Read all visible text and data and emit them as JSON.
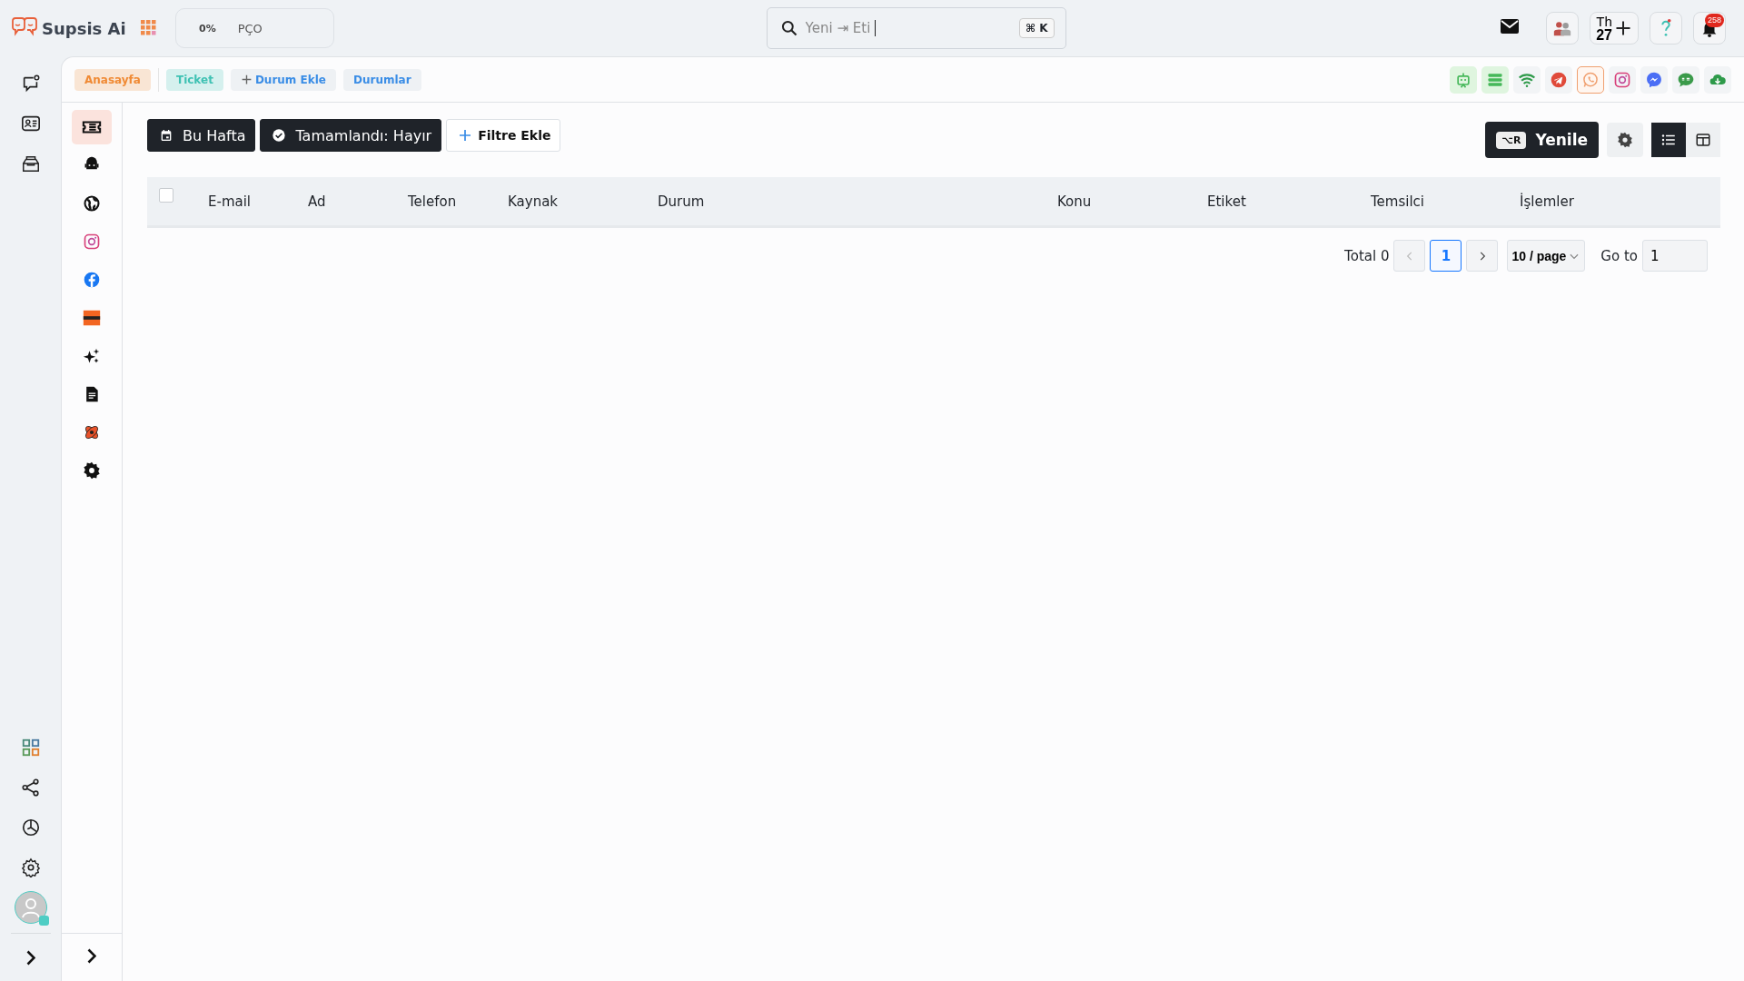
{
  "brand": {
    "name": "Supsis Ai"
  },
  "progress": {
    "percent": "0%",
    "label": "PÇO"
  },
  "search": {
    "value": "Yeni ⇥ Eti",
    "shortcut": "⌘ K"
  },
  "header_actions": {
    "calendar_day": "Th",
    "calendar_date": "27",
    "notification_count": "258"
  },
  "rail": {
    "items": [
      {
        "kind": "chat"
      },
      {
        "kind": "contact"
      },
      {
        "kind": "inbox"
      }
    ],
    "bottom_items": [
      {
        "kind": "apps"
      },
      {
        "kind": "share"
      },
      {
        "kind": "chart"
      },
      {
        "kind": "settings"
      }
    ],
    "user_online": true
  },
  "nav_tabs": [
    {
      "label": "Anasayfa",
      "color": "#f08a34",
      "kind": "tab"
    },
    {
      "label": "Ticket",
      "color": "#3ec1b3",
      "kind": "tab"
    },
    {
      "label": "Durum Ekle",
      "color": "#3a8de6",
      "kind": "add"
    },
    {
      "label": "Durumlar",
      "color": "#3a8de6",
      "kind": "tab"
    }
  ],
  "channels": [
    {
      "kind": "bot",
      "active": true,
      "selected": false
    },
    {
      "kind": "list",
      "active": true,
      "selected": false
    },
    {
      "kind": "wifi",
      "active": false,
      "selected": false
    },
    {
      "kind": "telegram",
      "active": false,
      "selected": false
    },
    {
      "kind": "whatsapp",
      "active": false,
      "selected": true
    },
    {
      "kind": "instagram",
      "active": false,
      "selected": false
    },
    {
      "kind": "messenger",
      "active": false,
      "selected": false
    },
    {
      "kind": "sms",
      "active": false,
      "selected": false
    },
    {
      "kind": "cloud",
      "active": false,
      "selected": false
    }
  ],
  "sidebar": {
    "items": [
      {
        "kind": "ticket",
        "selected": true
      },
      {
        "kind": "robot",
        "selected": false
      },
      {
        "kind": "globe",
        "selected": false
      },
      {
        "kind": "instagram",
        "selected": false
      },
      {
        "kind": "facebook",
        "selected": false
      },
      {
        "kind": "orange",
        "selected": false
      },
      {
        "kind": "sparkle",
        "selected": false
      },
      {
        "kind": "document",
        "selected": false
      },
      {
        "kind": "flower",
        "selected": false
      },
      {
        "kind": "gear",
        "selected": false
      }
    ]
  },
  "filters": [
    {
      "kind": "date",
      "label": "Bu Hafta"
    },
    {
      "kind": "check",
      "label": "Tamamlandı: Hayır"
    },
    {
      "kind": "add",
      "label": "Filtre Ekle"
    }
  ],
  "toolbar": {
    "refresh_shortcut": "⌥R",
    "refresh_label": "Yenile",
    "views": [
      {
        "kind": "list",
        "selected": true
      },
      {
        "kind": "columns",
        "selected": false
      }
    ]
  },
  "table": {
    "select_all_checked": false,
    "columns": [
      "E-mail",
      "Ad",
      "Telefon",
      "Kaynak",
      "Durum",
      "Konu",
      "Etiket",
      "Temsilci",
      "İşlemler"
    ]
  },
  "pagination": {
    "total": "Total 0",
    "pages": [
      {
        "label": "1",
        "selected": true
      }
    ],
    "page_size": "10 / page",
    "goto_label": "Go to",
    "goto_value": "1"
  }
}
